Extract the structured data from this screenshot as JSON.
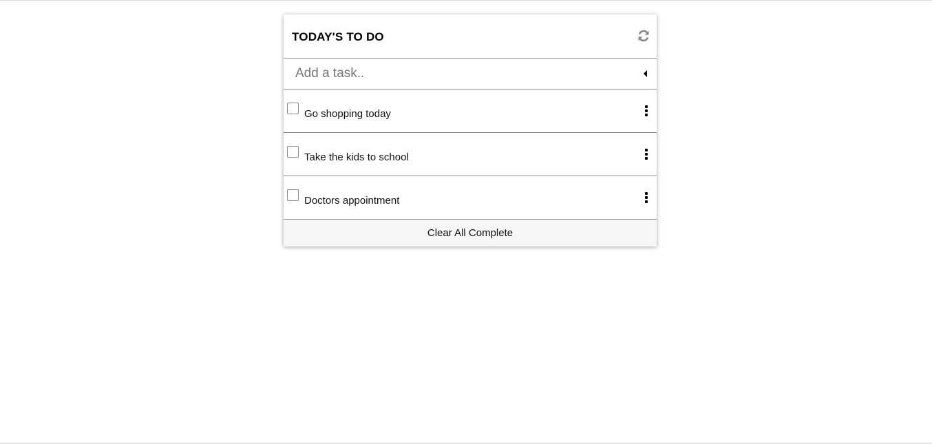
{
  "header": {
    "title": "TODAY'S TO DO",
    "refresh_icon": "refresh-icon"
  },
  "add_task": {
    "placeholder": "Add a task..",
    "value": "",
    "submit_icon": "caret-left-icon"
  },
  "tasks": [
    {
      "label": "Go shopping today",
      "completed": false,
      "menu_icon": "kebab-menu-icon"
    },
    {
      "label": "Take the kids to school",
      "completed": false,
      "menu_icon": "kebab-menu-icon"
    },
    {
      "label": "Doctors appointment",
      "completed": false,
      "menu_icon": "kebab-menu-icon"
    }
  ],
  "footer": {
    "clear_label": "Clear All Complete"
  },
  "colors": {
    "divider": "#8c8c8c",
    "footer_bg": "#f6f6f6",
    "icon_gray": "#888888"
  }
}
